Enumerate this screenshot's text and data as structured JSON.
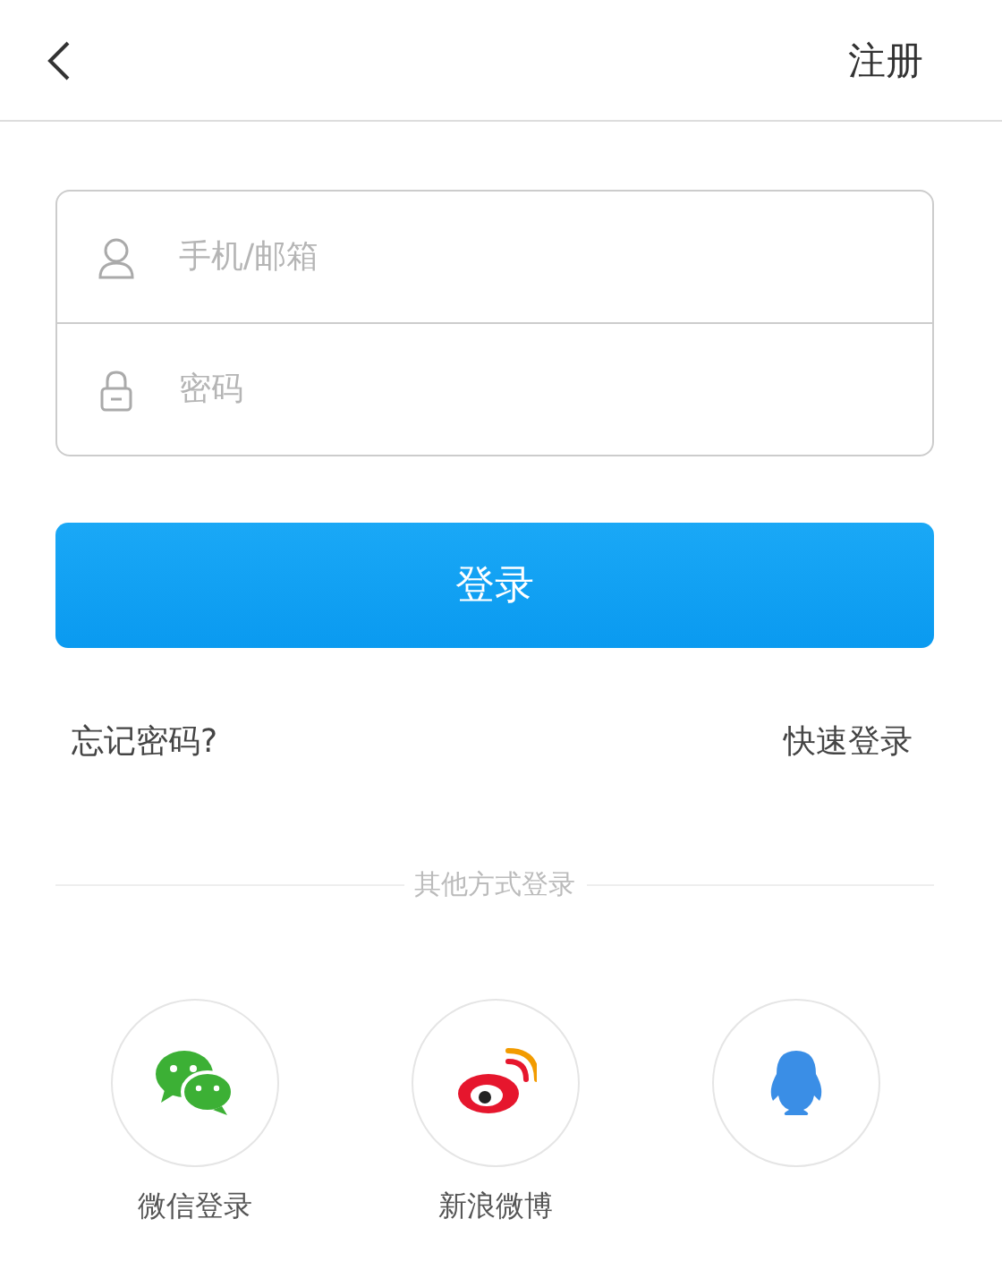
{
  "header": {
    "action": "注册"
  },
  "form": {
    "fields": [
      {
        "kind": "user",
        "placeholder": "手机/邮箱"
      },
      {
        "kind": "lock",
        "placeholder": "密码"
      }
    ]
  },
  "login_button": "登录",
  "links": {
    "forgot": "忘记密码?",
    "quick": "快速登录"
  },
  "divider": "其他方式登录",
  "social": [
    {
      "kind": "wechat",
      "label": "微信登录"
    },
    {
      "kind": "weibo",
      "label": "新浪微博"
    },
    {
      "kind": "qq"
    }
  ]
}
